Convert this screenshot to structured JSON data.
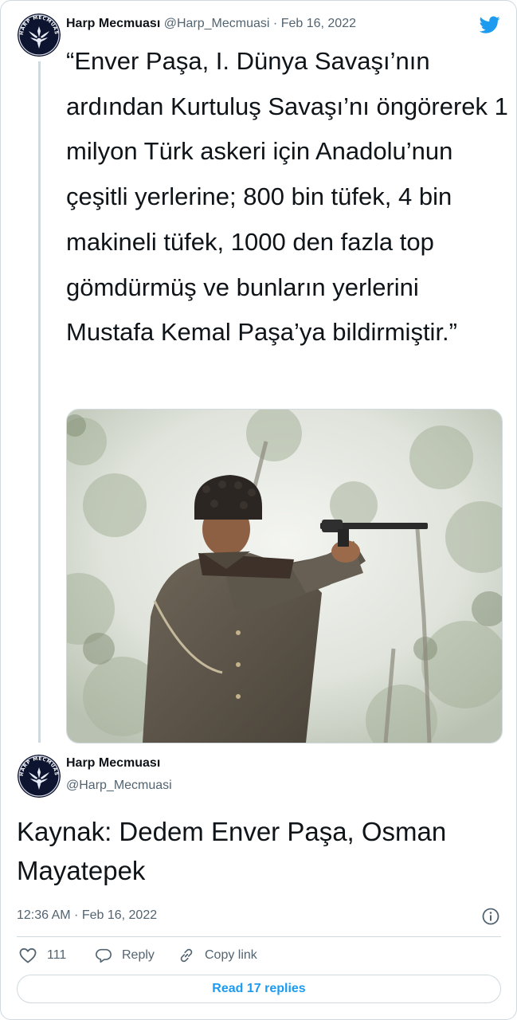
{
  "tweet1": {
    "author_name": "Harp Mecmuası",
    "handle": "@Harp_Mecmuasi",
    "separator": "·",
    "date": "Feb 16, 2022",
    "text": "“Enver Paşa, I. Dünya Savaşı’nın ardından Kurtuluş Savaşı’nı öngörerek 1 milyon Türk askeri için Anadolu’nun çeşitli yerlerine; 800 bin tüfek, 4 bin makineli tüfek, 1000 den fazla top gömdürmüş ve bunların yerlerini Mustafa Kemal Paşa’ya bildirmiştir.”",
    "avatar_icon": "harp-mecmuasi-logo",
    "avatar_ring_text": "HARP MECMUASI",
    "brand_icon": "twitter-bird-icon",
    "brand_color": "#1d9bf0"
  },
  "tweet2": {
    "author_name": "Harp Mecmuası",
    "handle": "@Harp_Mecmuasi",
    "text": "Kaynak: Dedem Enver Paşa, Osman Mayatepek",
    "timestamp": "12:36 AM · Feb 16, 2022",
    "info_icon": "info-icon"
  },
  "actions": {
    "like_count": "111",
    "reply_label": "Reply",
    "copy_link_label": "Copy link",
    "read_replies_label": "Read 17 replies"
  },
  "colors": {
    "text": "#0f1419",
    "muted": "#536471",
    "border": "#cfd9de",
    "accent": "#1d9bf0"
  }
}
